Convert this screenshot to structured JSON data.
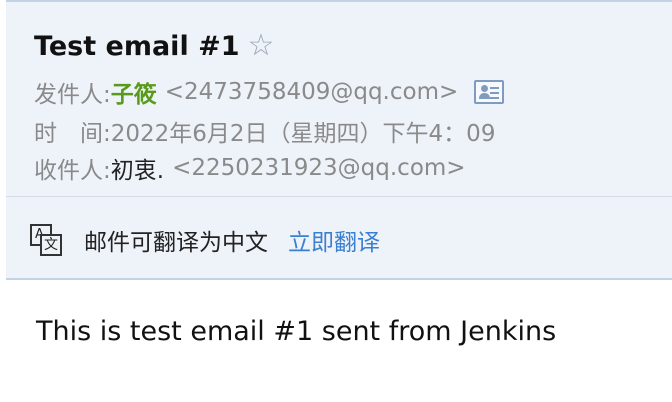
{
  "email": {
    "subject": "Test email #1",
    "star_icon": "star-outline-icon",
    "from_label": "发件人:",
    "from_name": "子筱",
    "from_address": "<2473758409@qq.com>",
    "contact_card_icon": "contact-card-icon",
    "time_label": "时　间:",
    "time_value": "2022年6月2日（星期四）下午4：09",
    "to_label": "收件人:",
    "to_name": "初衷.",
    "to_address": "<2250231923@qq.com>",
    "translate_icon": "translate-icon",
    "translate_notice": "邮件可翻译为中文",
    "translate_link": "立即翻译",
    "body": "This is test email #1 sent from Jenkins"
  },
  "colors": {
    "header_bg": "#eef3fa",
    "sender_name": "#5a9a1a",
    "link": "#3a7fd0"
  }
}
